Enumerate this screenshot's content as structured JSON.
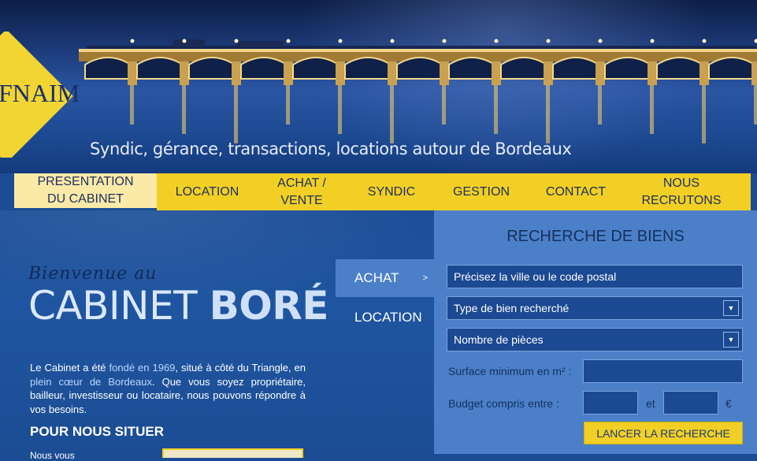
{
  "header": {
    "logo_text": "FNAIM",
    "tagline": "Syndic, gérance, transactions, locations autour de Bordeaux"
  },
  "nav": {
    "items": [
      {
        "line1": "PRESENTATION",
        "line2": "DU CABINET"
      },
      {
        "line1": "LOCATION",
        "line2": ""
      },
      {
        "line1": "ACHAT /",
        "line2": "VENTE"
      },
      {
        "line1": "SYNDIC",
        "line2": ""
      },
      {
        "line1": "GESTION",
        "line2": ""
      },
      {
        "line1": "CONTACT",
        "line2": ""
      },
      {
        "line1": "NOUS",
        "line2": "RECRUTONS"
      }
    ]
  },
  "welcome": {
    "script": "Bienvenue au",
    "title_light": "CABINET",
    "title_bold": "BORÉ",
    "intro_1": "Le Cabinet a été ",
    "intro_hl1": "fondé en 1969",
    "intro_2": ", situé à côté du Triangle, en ",
    "intro_hl2": "plein cœur de Bordeaux",
    "intro_3": ". Que vous soyez propriétaire, bailleur, investisseur ou locataire, nous pouvons répondre à vos besoins.",
    "situer": "POUR NOUS SITUER",
    "situer_text": "Nous vous"
  },
  "tabs": {
    "achat": "ACHAT",
    "location": "LOCATION",
    "chevron": ">"
  },
  "search": {
    "title": "RECHERCHE DE BIENS",
    "city_placeholder": "Précisez la ville ou le code postal",
    "type_placeholder": "Type de bien recherché",
    "rooms_placeholder": "Nombre de pièces",
    "surface_label": "Surface minimum en m² :",
    "budget_label": "Budget compris entre :",
    "et": "et",
    "euro": "€",
    "button": "LANCER LA RECHERCHE"
  },
  "colors": {
    "brand_yellow": "#f2cf24",
    "brand_blue": "#1c4d94",
    "panel_blue": "#4b80c8"
  }
}
